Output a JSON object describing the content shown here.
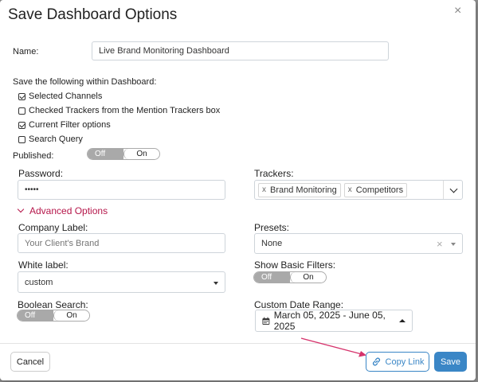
{
  "dialog": {
    "title": "Save Dashboard Options",
    "close_label": "×"
  },
  "name": {
    "label": "Name:",
    "value": "Live Brand Monitoring Dashboard"
  },
  "save_within": {
    "label": "Save the following within Dashboard:",
    "options": [
      {
        "label": "Selected Channels",
        "checked": true
      },
      {
        "label": "Checked Trackers from the Mention Trackers box",
        "checked": false
      },
      {
        "label": "Current Filter options",
        "checked": true
      },
      {
        "label": "Search Query",
        "checked": false
      }
    ]
  },
  "published": {
    "label": "Published:",
    "off_label": "Off",
    "on_label": "On",
    "state": "on"
  },
  "password": {
    "label": "Password:",
    "value": "•••••"
  },
  "trackers": {
    "label": "Trackers:",
    "remove_label": "x",
    "tags": [
      "Brand Monitoring",
      "Competitors"
    ]
  },
  "advanced": {
    "label": "Advanced Options"
  },
  "company_label": {
    "label": "Company Label:",
    "placeholder": "Your Client's Brand"
  },
  "presets": {
    "label": "Presets:",
    "value": "None",
    "clear_label": "×"
  },
  "white_label": {
    "label": "White label:",
    "value": "custom"
  },
  "show_basic_filters": {
    "label": "Show Basic Filters:",
    "off_label": "Off",
    "on_label": "On",
    "state": "on"
  },
  "boolean_search": {
    "label": "Boolean Search:",
    "off_label": "Off",
    "on_label": "On",
    "state": "on"
  },
  "date_range": {
    "label": "Custom Date Range:",
    "value": "March 05, 2025 - June 05, 2025"
  },
  "footer": {
    "cancel_label": "Cancel",
    "copy_link_label": "Copy Link",
    "save_label": "Save"
  },
  "colors": {
    "accent": "#3a86c6",
    "advanced": "#b5164a",
    "annotation_arrow": "#d6336c"
  }
}
